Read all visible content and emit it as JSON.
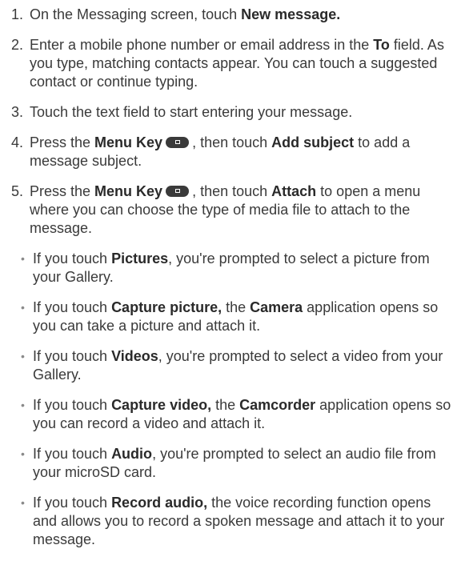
{
  "steps": [
    {
      "num": "1.",
      "parts": [
        {
          "t": "On the Messaging screen, touch "
        },
        {
          "t": "New message.",
          "b": true
        }
      ]
    },
    {
      "num": "2.",
      "parts": [
        {
          "t": "Enter a mobile phone number or email address in the "
        },
        {
          "t": "To",
          "b": true
        },
        {
          "t": " field. As you type, matching contacts appear. You can touch a suggested contact or continue typing."
        }
      ]
    },
    {
      "num": "3.",
      "parts": [
        {
          "t": "Touch the text field to start entering your message."
        }
      ]
    },
    {
      "num": "4.",
      "parts": [
        {
          "t": "Press the "
        },
        {
          "t": "Menu Key",
          "b": true
        },
        {
          "icon": "menu-key-icon"
        },
        {
          "t": ", then touch "
        },
        {
          "t": "Add subject",
          "b": true
        },
        {
          "t": " to add a message subject."
        }
      ]
    },
    {
      "num": "5.",
      "parts": [
        {
          "t": "Press the "
        },
        {
          "t": "Menu Key",
          "b": true
        },
        {
          "icon": "menu-key-icon"
        },
        {
          "t": ", then touch "
        },
        {
          "t": "Attach",
          "b": true
        },
        {
          "t": " to open a menu where you can choose the type of media file to attach to the message."
        }
      ]
    }
  ],
  "bullets": [
    [
      {
        "t": "If you touch "
      },
      {
        "t": "Pictures",
        "b": true
      },
      {
        "t": ", you're prompted to select a picture from your Gallery."
      }
    ],
    [
      {
        "t": "If you touch "
      },
      {
        "t": "Capture picture,",
        "b": true
      },
      {
        "t": " the "
      },
      {
        "t": "Camera",
        "b": true
      },
      {
        "t": " application opens so you can take a picture and attach it."
      }
    ],
    [
      {
        "t": "If you touch "
      },
      {
        "t": "Videos",
        "b": true
      },
      {
        "t": ", you're prompted to select a video from your Gallery."
      }
    ],
    [
      {
        "t": "If you touch "
      },
      {
        "t": "Capture video,",
        "b": true
      },
      {
        "t": " the "
      },
      {
        "t": "Camcorder",
        "b": true
      },
      {
        "t": " application opens so you can record a video and attach it."
      }
    ],
    [
      {
        "t": "If you touch "
      },
      {
        "t": "Audio",
        "b": true
      },
      {
        "t": ", you're prompted to select an audio file from your microSD card."
      }
    ],
    [
      {
        "t": "If you touch "
      },
      {
        "t": "Record audio,",
        "b": true
      },
      {
        "t": " the voice recording function opens and allows you to record a spoken message and attach it to your message."
      }
    ]
  ],
  "bullet_glyph": "•"
}
